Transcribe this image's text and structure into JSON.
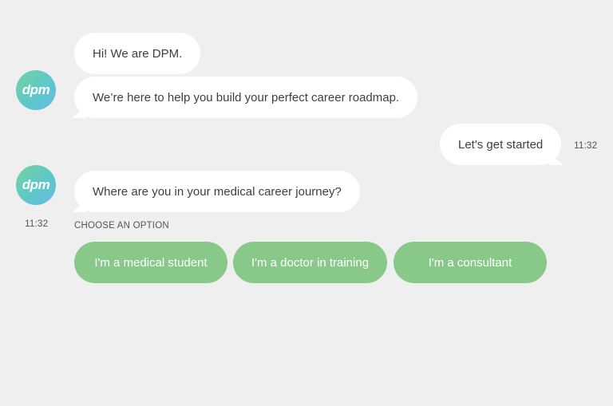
{
  "avatar": {
    "text": "dpm"
  },
  "messages": [
    {
      "sender": "bot",
      "text": "Hi! We are DPM."
    },
    {
      "sender": "bot",
      "text": "We’re here to help you build your perfect career roadmap."
    },
    {
      "sender": "user",
      "text": "Let's get started",
      "time": "11:32"
    },
    {
      "sender": "bot",
      "text": "Where are you in your medical career journey?",
      "time": "11:32"
    }
  ],
  "options": {
    "label": "CHOOSE AN OPTION",
    "items": [
      "I'm a medical student",
      "I'm a doctor in training",
      "I'm a consultant"
    ]
  },
  "colors": {
    "background": "#efefef",
    "bubble": "#ffffff",
    "option_button": "#88c98a",
    "avatar_gradient_start": "#74d3a0",
    "avatar_gradient_end": "#67b9e6"
  }
}
